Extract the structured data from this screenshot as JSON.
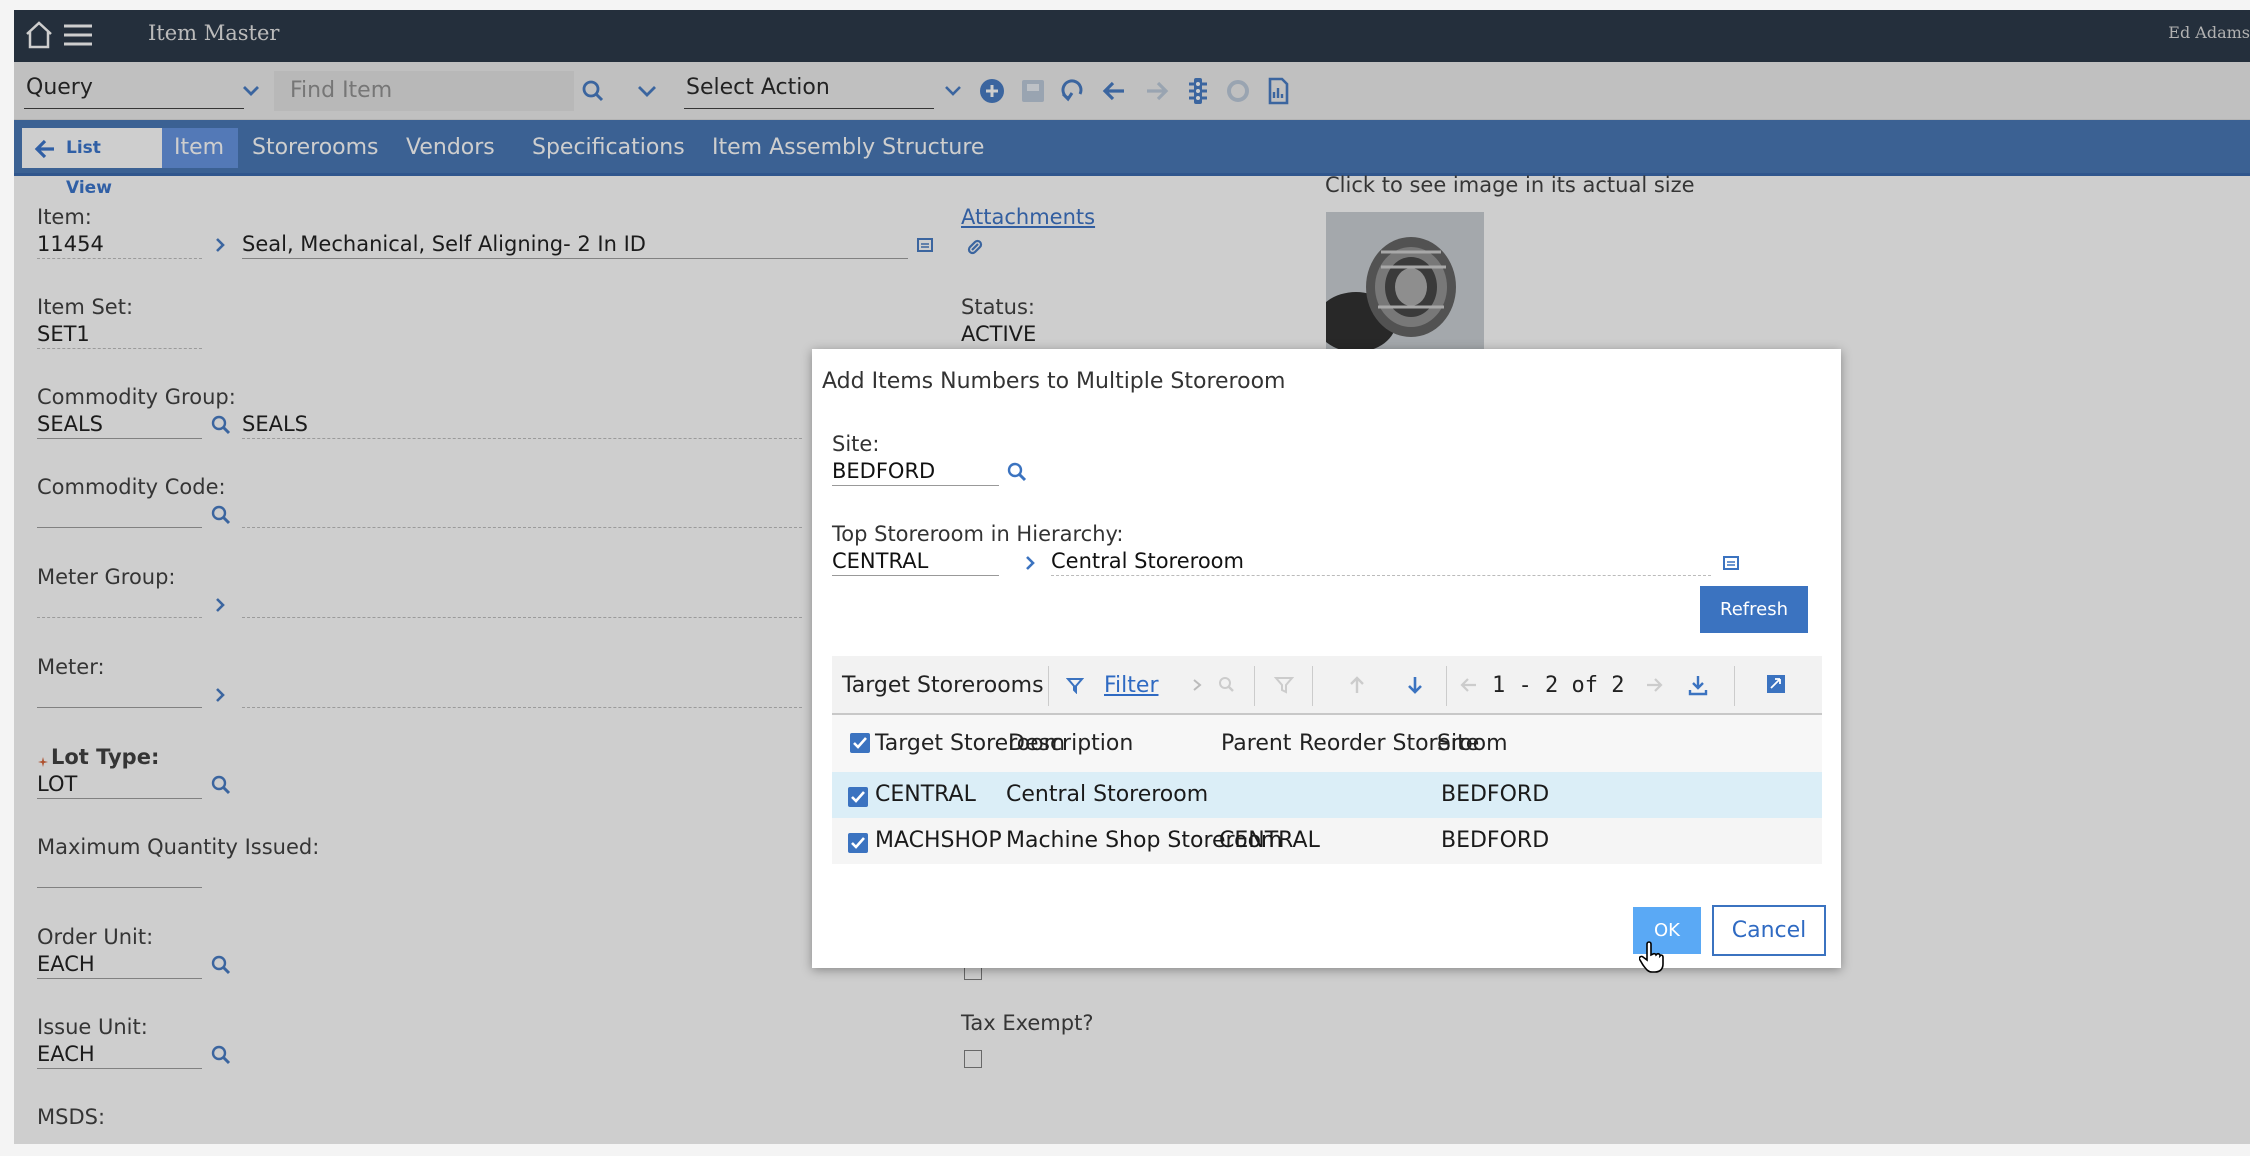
{
  "topbar": {
    "title": "Item Master",
    "user": "Ed Adams"
  },
  "toolbar": {
    "query_value": "Query",
    "find_placeholder": "Find Item",
    "action_value": "Select Action"
  },
  "tabs": {
    "list_view": "List View",
    "items": [
      "Item",
      "Storerooms",
      "Vendors",
      "Specifications",
      "Item Assembly Structure"
    ],
    "active": "Item"
  },
  "form": {
    "item_label": "Item:",
    "item_value": "11454",
    "item_description": "Seal, Mechanical, Self Aligning- 2 In ID",
    "item_set_label": "Item Set:",
    "item_set_value": "SET1",
    "commodity_group_label": "Commodity Group:",
    "commodity_group_value": "SEALS",
    "commodity_group_desc": "SEALS",
    "commodity_code_label": "Commodity Code:",
    "meter_group_label": "Meter Group:",
    "meter_label": "Meter:",
    "lot_type_label": "Lot Type:",
    "lot_type_value": "LOT",
    "max_qty_label": "Maximum Quantity Issued:",
    "order_unit_label": "Order Unit:",
    "order_unit_value": "EACH",
    "issue_unit_label": "Issue Unit:",
    "issue_unit_value": "EACH",
    "msds_label": "MSDS:",
    "attachments_label": "Attachments",
    "status_label": "Status:",
    "status_value": "ACTIVE",
    "tax_exempt_label": "Tax Exempt?",
    "image_caption": "Click to see image in its actual size"
  },
  "dialog": {
    "title": "Add Items Numbers to Multiple Storeroom",
    "site_label": "Site:",
    "site_value": "BEDFORD",
    "top_storeroom_label": "Top Storeroom in Hierarchy:",
    "top_storeroom_value": "CENTRAL",
    "top_storeroom_desc": "Central Storeroom",
    "refresh_label": "Refresh",
    "table_title": "Target Storerooms",
    "filter_label": "Filter",
    "pagination": "1 - 2 of 2",
    "columns": [
      "Target Storeroom",
      "Description",
      "Parent",
      "Reorder Storeroom",
      "Site"
    ],
    "rows": [
      {
        "storeroom": "CENTRAL",
        "description": "Central Storeroom",
        "parent": "",
        "reorder": "",
        "site": "BEDFORD",
        "checked": true
      },
      {
        "storeroom": "MACHSHOP",
        "description": "Machine Shop Storeroom",
        "parent": "CENTRAL",
        "reorder": "",
        "site": "BEDFORD",
        "checked": true
      }
    ],
    "ok_label": "OK",
    "cancel_label": "Cancel"
  },
  "colors": {
    "header": "#1c2b3c",
    "tabbar": "#3b6eb0",
    "accent": "#3b73c0",
    "ok_button": "#5aa9f5",
    "selected_row": "#dbeef7"
  },
  "icons": [
    "home-icon",
    "hamburger-menu-icon",
    "search-icon",
    "chevron-down-icon",
    "add-icon",
    "save-icon",
    "undo-icon",
    "back-arrow-icon",
    "forward-arrow-icon",
    "workflow-icon",
    "refresh-icon",
    "report-icon",
    "attachment-icon",
    "filter-icon",
    "download-icon",
    "detail-menu-icon",
    "checkbox-icon",
    "hand-cursor-icon"
  ]
}
